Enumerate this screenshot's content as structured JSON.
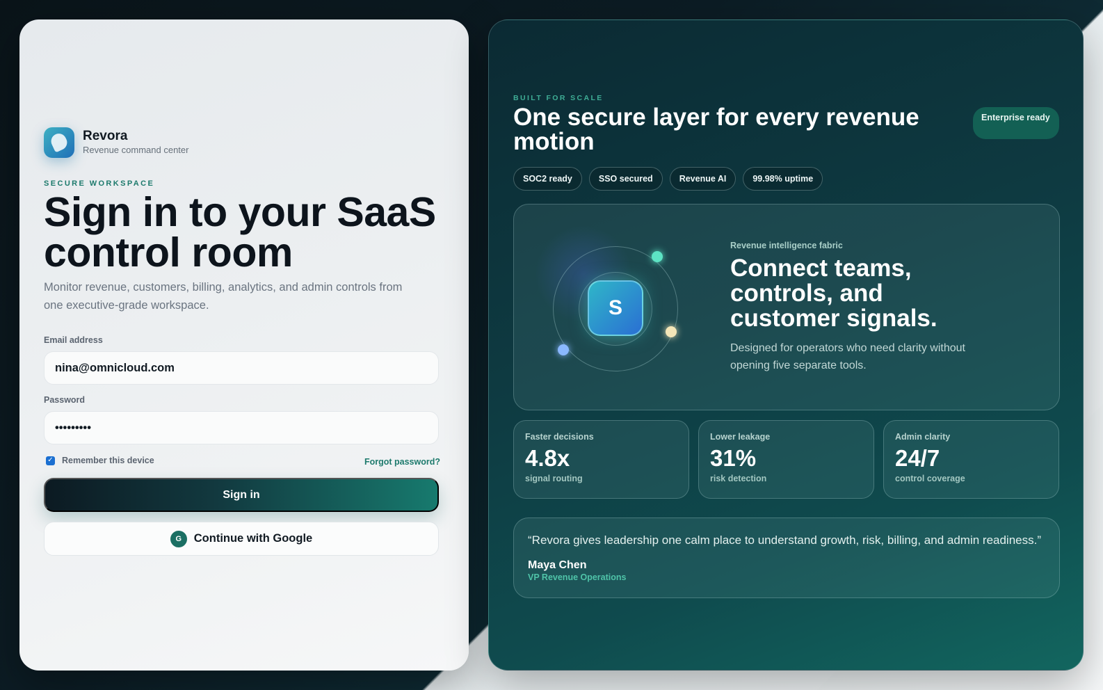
{
  "brand": {
    "name": "Revora",
    "tagline": "Revenue command center"
  },
  "login": {
    "eyebrow": "SECURE WORKSPACE",
    "title": "Sign in to your SaaS control room",
    "lead": "Monitor revenue, customers, billing, analytics, and admin controls from one executive-grade workspace.",
    "email_label": "Email address",
    "email_value": "nina@omnicloud.com",
    "password_label": "Password",
    "password_value": "•••••••••",
    "remember_label": "Remember this device",
    "remember_checked": true,
    "forgot_label": "Forgot password?",
    "signin_label": "Sign in",
    "google_badge": "G",
    "google_label": "Continue with Google"
  },
  "showcase": {
    "eyebrow": "BUILT FOR SCALE",
    "title": "One secure layer for every revenue motion",
    "badge": "Enterprise ready",
    "pills": [
      "SOC2 ready",
      "SSO secured",
      "Revenue AI",
      "99.98% uptime"
    ],
    "hero": {
      "tile_letter": "S",
      "eyebrow": "Revenue intelligence fabric",
      "title": "Connect teams, controls, and customer signals.",
      "subtitle": "Designed for operators who need clarity without opening five separate tools."
    },
    "stats": [
      {
        "label": "Faster decisions",
        "value": "4.8x",
        "sub": "signal routing"
      },
      {
        "label": "Lower leakage",
        "value": "31%",
        "sub": "risk detection"
      },
      {
        "label": "Admin clarity",
        "value": "24/7",
        "sub": "control coverage"
      }
    ],
    "testimonial": {
      "quote": "“Revora gives leadership one calm place to understand growth, risk, billing, and admin readiness.”",
      "name": "Maya Chen",
      "role": "VP Revenue Operations"
    }
  },
  "colors": {
    "accent_teal": "#1d7a6c",
    "primary_dark": "#0c1a22",
    "panel_dark": "#0e3b42",
    "checkbox_blue": "#1b6fd1"
  },
  "icons": {
    "brand": "brand-logo-icon",
    "checkbox": "checkbox-checked-icon",
    "google": "google-badge-icon"
  }
}
